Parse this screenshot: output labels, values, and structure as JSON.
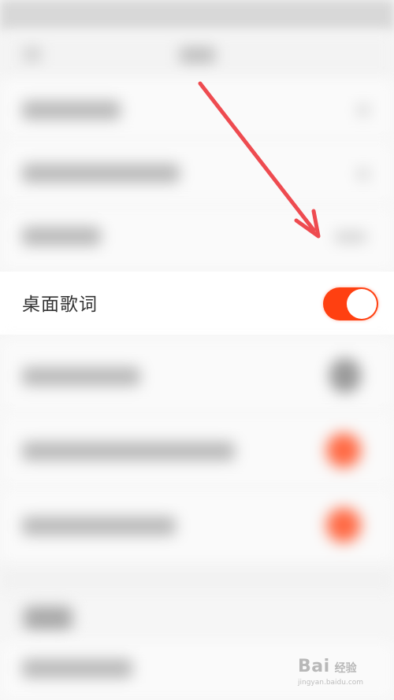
{
  "setting_row": {
    "label": "桌面歌词",
    "toggle_on": true,
    "accent_color": "#ff4011"
  },
  "watermark": {
    "brand": "Bai",
    "brand_suffix": "经验",
    "url": "jingyan.baidu.com"
  },
  "annotation": {
    "type": "arrow",
    "color": "#ee4b50"
  }
}
